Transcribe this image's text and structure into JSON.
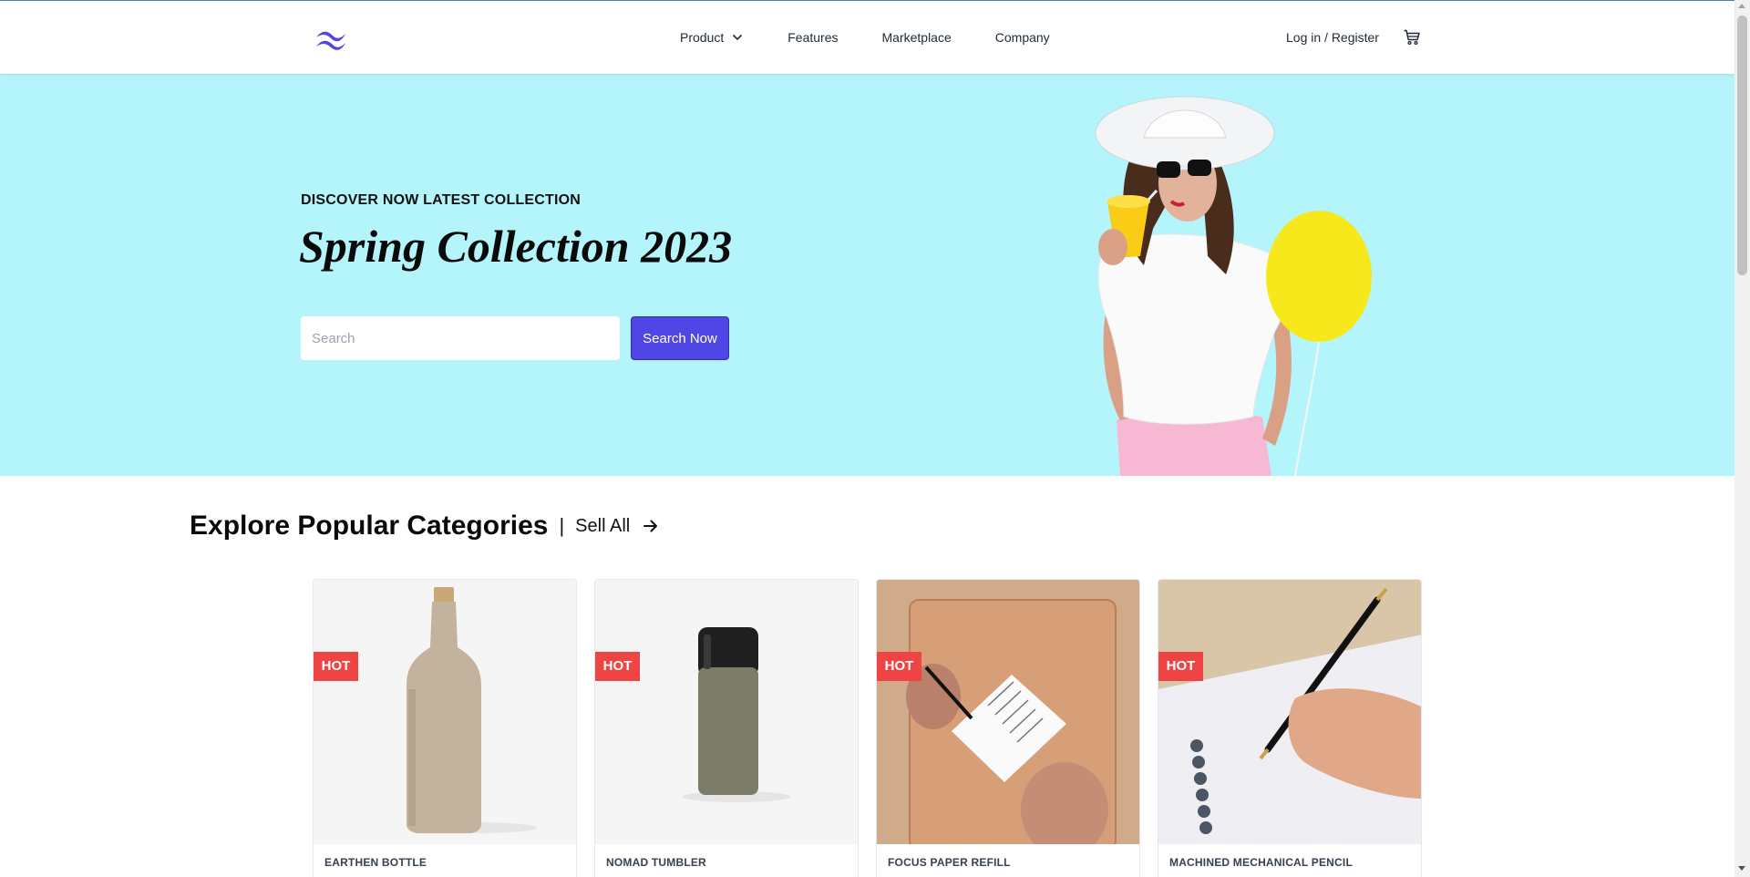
{
  "header": {
    "logo_icon": "wave-logo-icon",
    "nav": [
      {
        "label": "Product",
        "has_dropdown": true
      },
      {
        "label": "Features"
      },
      {
        "label": "Marketplace"
      },
      {
        "label": "Company"
      }
    ],
    "login_label": "Log in / Register",
    "cart_icon": "cart-icon"
  },
  "hero": {
    "subtitle": "DISCOVER NOW LATEST COLLECTION",
    "title": "Spring Collection 2023",
    "search_placeholder": "Search",
    "search_value": "",
    "search_button": "Search Now",
    "background_color": "#b3f5fb"
  },
  "categories": {
    "title": "Explore Popular Categories",
    "separator": "|",
    "sell_all_label": "Sell All",
    "items": [
      {
        "name": "EARTHEN BOTTLE",
        "badge": "HOT"
      },
      {
        "name": "NOMAD TUMBLER",
        "badge": "HOT"
      },
      {
        "name": "FOCUS PAPER REFILL",
        "badge": "HOT"
      },
      {
        "name": "MACHINED MECHANICAL PENCIL",
        "badge": "HOT"
      }
    ]
  },
  "colors": {
    "accent": "#4f46e5",
    "badge": "#ef4444"
  }
}
